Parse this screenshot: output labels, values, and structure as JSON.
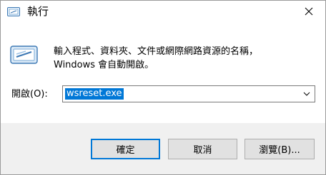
{
  "window": {
    "title": "執行"
  },
  "description": {
    "line1": "輸入程式、資料夾、文件或網際網路資源的名稱，",
    "line2": "Windows 會自動開啟。"
  },
  "open_field": {
    "label": "開啟(O):",
    "value": "wsreset.exe"
  },
  "buttons": {
    "ok": "確定",
    "cancel": "取消",
    "browse": "瀏覽(B)..."
  },
  "colors": {
    "selection": "#0078d7",
    "footer": "#f0f0f0",
    "button_face": "#e1e1e1"
  },
  "icons": [
    "run-icon",
    "close-icon",
    "chevron-down-icon"
  ]
}
